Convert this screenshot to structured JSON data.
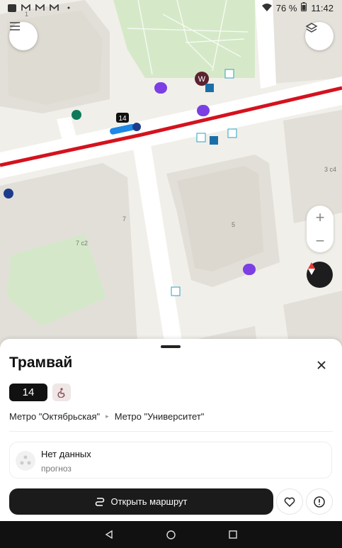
{
  "status_bar": {
    "left_icons": [
      "photos-icon",
      "gmail-icon",
      "gmail-icon",
      "gmail-icon",
      "dot-icon"
    ],
    "battery": "76 %",
    "time": "11:42"
  },
  "map": {
    "building_labels": [
      "1",
      "3 с4",
      "7",
      "7 с2",
      "5"
    ],
    "vehicle_route_number": "14",
    "colors": {
      "route_line": "#d4121e",
      "vehicle": "#1e88e5",
      "poi_purple": "#7b3fe4",
      "buildings": "#e2dfd9",
      "park": "#cde6c1"
    }
  },
  "sheet": {
    "title": "Трамвай",
    "route_number": "14",
    "from_stop": "Метро \"Октябрьская\"",
    "to_stop": "Метро \"Университет\"",
    "forecast_title": "Нет данных",
    "forecast_subtitle": "прогноз",
    "open_route_label": "Открыть маршрут"
  }
}
